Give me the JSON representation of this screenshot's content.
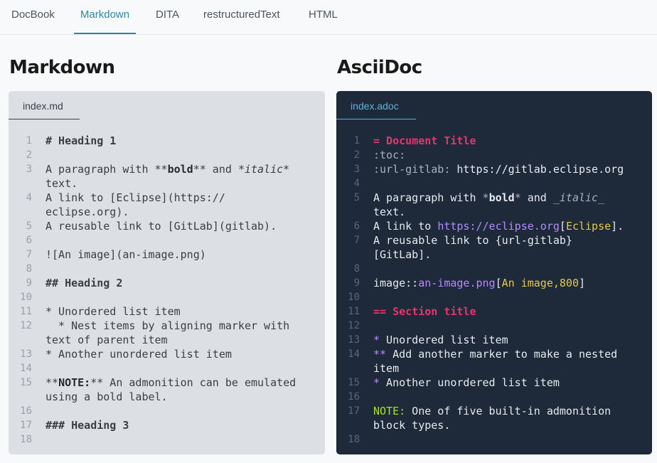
{
  "nav": {
    "tabs": [
      "DocBook",
      "Markdown",
      "DITA",
      "restructuredText",
      "HTML"
    ],
    "active": "Markdown"
  },
  "markdown": {
    "heading": "Markdown",
    "file": "index.md",
    "lines": [
      {
        "n": "1",
        "t": "# Heading 1"
      },
      {
        "n": "2",
        "t": ""
      },
      {
        "n": "3",
        "t": "A paragraph with **bold** and *italic*"
      },
      {
        "n": "",
        "t": "text."
      },
      {
        "n": "4",
        "t": "A link to [Eclipse](https://"
      },
      {
        "n": "",
        "t": "eclipse.org)."
      },
      {
        "n": "5",
        "t": "A reusable link to [GitLab](gitlab)."
      },
      {
        "n": "6",
        "t": ""
      },
      {
        "n": "7",
        "t": "![An image](an-image.png)"
      },
      {
        "n": "8",
        "t": ""
      },
      {
        "n": "9",
        "t": "## Heading 2"
      },
      {
        "n": "10",
        "t": ""
      },
      {
        "n": "11",
        "t": "* Unordered list item"
      },
      {
        "n": "12",
        "t": "  * Nest items by aligning marker with"
      },
      {
        "n": "",
        "t": "text of parent item"
      },
      {
        "n": "13",
        "t": "* Another unordered list item"
      },
      {
        "n": "14",
        "t": ""
      },
      {
        "n": "15",
        "t": "**NOTE:** An admonition can be emulated"
      },
      {
        "n": "",
        "t": "using a bold label."
      },
      {
        "n": "16",
        "t": ""
      },
      {
        "n": "17",
        "t": "### Heading 3"
      },
      {
        "n": "18",
        "t": ""
      }
    ]
  },
  "asciidoc": {
    "heading": "AsciiDoc",
    "file": "index.adoc",
    "lines": [
      {
        "n": "1",
        "t": "= Document Title"
      },
      {
        "n": "2",
        "t": ":toc:"
      },
      {
        "n": "3",
        "t": ":url-gitlab: https://gitlab.eclipse.org"
      },
      {
        "n": "4",
        "t": ""
      },
      {
        "n": "5",
        "t": "A paragraph with *bold* and _italic_"
      },
      {
        "n": "",
        "t": "text."
      },
      {
        "n": "6",
        "t": "A link to https://eclipse.org[Eclipse]."
      },
      {
        "n": "7",
        "t": "A reusable link to {url-gitlab}"
      },
      {
        "n": "",
        "t": "[GitLab]."
      },
      {
        "n": "8",
        "t": ""
      },
      {
        "n": "9",
        "t": "image::an-image.png[An image,800]"
      },
      {
        "n": "10",
        "t": ""
      },
      {
        "n": "11",
        "t": "== Section title"
      },
      {
        "n": "12",
        "t": ""
      },
      {
        "n": "13",
        "t": "* Unordered list item"
      },
      {
        "n": "14",
        "t": "** Add another marker to make a nested"
      },
      {
        "n": "",
        "t": "item"
      },
      {
        "n": "15",
        "t": "* Another unordered list item"
      },
      {
        "n": "16",
        "t": ""
      },
      {
        "n": "17",
        "t": "NOTE: One of five built-in admonition"
      },
      {
        "n": "",
        "t": "block types."
      },
      {
        "n": "18",
        "t": ""
      }
    ]
  },
  "colors": {
    "accent": "#2b8aa0",
    "dark_bg": "#1e2a3a",
    "light_bg": "#dcdfe3",
    "heading_pink": "#e8336e",
    "url_purple": "#b68aff",
    "attr_yellow": "#e6c84a",
    "admonition_green": "#a6e22e"
  }
}
